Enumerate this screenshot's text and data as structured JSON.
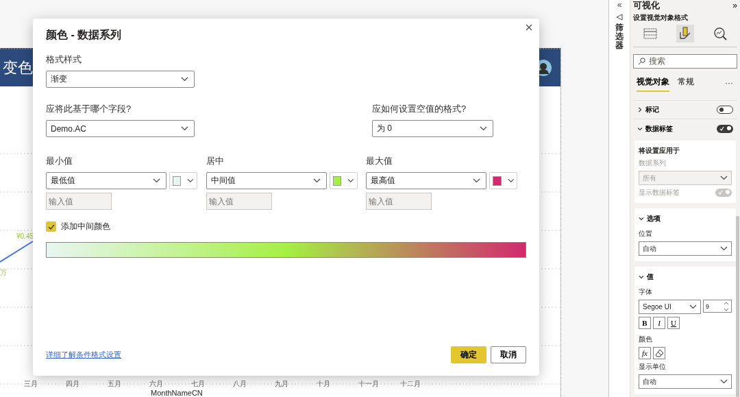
{
  "report": {
    "visual_title": "变色",
    "data_labels": [
      "¥0.45",
      "万"
    ],
    "x_axis": {
      "labels": [
        "三月",
        "四月",
        "五月",
        "六月",
        "七月",
        "八月",
        "九月",
        "十月",
        "十一月",
        "十二月"
      ],
      "title": "MonthNameCN"
    }
  },
  "dialog": {
    "title": "颜色 - 数据系列",
    "format_style": {
      "label": "格式样式",
      "value": "渐变"
    },
    "based_on_field": {
      "label": "应将此基于哪个字段?",
      "value": "Demo.AC"
    },
    "empty_values": {
      "label": "应如何设置空值的格式?",
      "value": "为 0"
    },
    "stops": [
      {
        "label": "最小值",
        "value": "最低值",
        "color": "#e8f6f2",
        "placeholder": "输入值",
        "disabled": true
      },
      {
        "label": "居中",
        "value": "中间值",
        "color": "#a4f045",
        "placeholder": "输入值",
        "disabled": true
      },
      {
        "label": "最大值",
        "value": "最高值",
        "color": "#d12a6e",
        "placeholder": "输入值",
        "disabled": true
      }
    ],
    "middle_color": {
      "label": "添加中间颜色",
      "checked": true
    },
    "link": "详细了解条件格式设置",
    "buttons": [
      {
        "label": "确定",
        "kind": "primary"
      },
      {
        "label": "取消",
        "kind": "secondary"
      }
    ]
  },
  "filters_pane": {
    "collapse": "«",
    "label": "筛选器"
  },
  "visualizations_pane": {
    "title": "可视化",
    "expand": "»",
    "subtitle": "设置视觉对象格式",
    "view_icons": [
      {
        "kind": "fields",
        "selected": false
      },
      {
        "kind": "format",
        "selected": true
      },
      {
        "kind": "analytics",
        "selected": false
      }
    ],
    "search": {
      "placeholder": "搜索"
    },
    "tabs": [
      {
        "label": "视觉对象",
        "selected": true
      },
      {
        "label": "常规",
        "selected": false
      }
    ],
    "more": "···",
    "sections": [
      {
        "kind": "toggle",
        "title": "标记",
        "expanded": false,
        "on": false
      },
      {
        "kind": "toggle",
        "title": "数据标签",
        "expanded": true,
        "on": true
      },
      {
        "kind": "apply",
        "title": "将设置应用于",
        "series_label": "数据系列",
        "series_value": "所有",
        "show_label": "显示数据标签",
        "show_on": true,
        "disabled": true
      },
      {
        "kind": "options",
        "title": "选项",
        "expanded": true,
        "position_label": "位置",
        "position_value": "自动"
      },
      {
        "kind": "values",
        "title": "值",
        "expanded": true,
        "font_label": "字体",
        "font_value": "Segoe UI",
        "size_value": "9",
        "styles": [
          "B",
          "I",
          "U"
        ],
        "color_label": "颜色",
        "fx": "fx",
        "units_label": "显示单位",
        "units_value": "自动"
      }
    ]
  }
}
